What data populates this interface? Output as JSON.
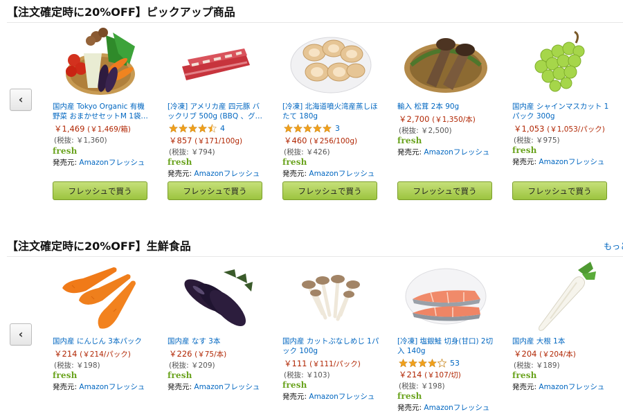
{
  "sections": [
    {
      "title": "【注文確定時に20%OFF】ピックアップ商品",
      "products": [
        {
          "title": "国内産 Tokyo Organic 有機野菜 おまかせセットM 1袋…",
          "price": "￥1,469",
          "unit_price": "(￥1,469/箱)",
          "tax_excluded": "(税抜: ￥1,360)",
          "rating": null,
          "reviews": null,
          "fresh": "fresh",
          "seller_label": "発売元:",
          "seller": "Amazonフレッシュ",
          "button": "フレッシュで買う",
          "icon": "vegetable-basket-icon"
        },
        {
          "title": "[冷凍] アメリカ産 四元豚 バックリブ 500g (BBQ 、グ…",
          "price": "￥857",
          "unit_price": "(￥171/100g)",
          "tax_excluded": "(税抜: ￥794)",
          "rating": 4.5,
          "reviews": "4",
          "fresh": "fresh",
          "seller_label": "発売元:",
          "seller": "Amazonフレッシュ",
          "button": "フレッシュで買う",
          "icon": "pork-ribs-icon"
        },
        {
          "title": "[冷凍] 北海道噴火湾産蒸しほたて 180g",
          "price": "￥460",
          "unit_price": "(￥256/100g)",
          "tax_excluded": "(税抜: ￥426)",
          "rating": 5,
          "reviews": "3",
          "fresh": "fresh",
          "seller_label": "発売元:",
          "seller": "Amazonフレッシュ",
          "button": "フレッシュで買う",
          "icon": "scallop-plate-icon"
        },
        {
          "title": "輸入 松茸 2本 90g",
          "price": "￥2,700",
          "unit_price": "(￥1,350/本)",
          "tax_excluded": "(税抜: ￥2,500)",
          "rating": null,
          "reviews": null,
          "fresh": "fresh",
          "seller_label": "発売元:",
          "seller": "Amazonフレッシュ",
          "button": "フレッシュで買う",
          "icon": "matsutake-icon"
        },
        {
          "title": "国内産 シャインマスカット 1パック 300g",
          "price": "￥1,053",
          "unit_price": "(￥1,053/パック)",
          "tax_excluded": "(税抜: ￥975)",
          "rating": null,
          "reviews": null,
          "fresh": "fresh",
          "seller_label": "発売元:",
          "seller": "Amazonフレッシュ",
          "button": "フレッシュで買う",
          "icon": "grapes-icon"
        }
      ]
    },
    {
      "title": "【注文確定時に20%OFF】生鮮食品",
      "more": "もっと",
      "products": [
        {
          "title": "国内産 にんじん 3本パック",
          "price": "￥214",
          "unit_price": "(￥214/パック)",
          "tax_excluded": "(税抜: ￥198)",
          "rating": null,
          "reviews": null,
          "fresh": "fresh",
          "seller_label": "発売元:",
          "seller": "Amazonフレッシュ",
          "icon": "carrot-icon"
        },
        {
          "title": "国内産 なす 3本",
          "price": "￥226",
          "unit_price": "(￥75/本)",
          "tax_excluded": "(税抜: ￥209)",
          "rating": null,
          "reviews": null,
          "fresh": "fresh",
          "seller_label": "発売元:",
          "seller": "Amazonフレッシュ",
          "icon": "eggplant-icon"
        },
        {
          "title": "国内産 カットぶなしめじ 1パック 100g",
          "price": "￥111",
          "unit_price": "(￥111/パック)",
          "tax_excluded": "(税抜: ￥103)",
          "rating": null,
          "reviews": null,
          "fresh": "fresh",
          "seller_label": "発売元:",
          "seller": "Amazonフレッシュ",
          "icon": "shimeji-icon"
        },
        {
          "title": "[冷凍] 塩銀鮭 切身(甘口) 2切入 140g",
          "price": "￥214",
          "unit_price": "(￥107/切)",
          "tax_excluded": "(税抜: ￥198)",
          "rating": 4,
          "reviews": "53",
          "fresh": "fresh",
          "seller_label": "発売元:",
          "seller": "Amazonフレッシュ",
          "icon": "salmon-icon"
        },
        {
          "title": "国内産 大根 1本",
          "price": "￥204",
          "unit_price": "(￥204/本)",
          "tax_excluded": "(税抜: ￥189)",
          "rating": null,
          "reviews": null,
          "fresh": "fresh",
          "seller_label": "発売元:",
          "seller": "Amazonフレッシュ",
          "icon": "daikon-icon"
        }
      ]
    }
  ],
  "prev_arrow": "‹",
  "colors": {
    "link": "#0066c0",
    "price": "#b12704",
    "star": "#f0a01c",
    "fresh": "#6aa31e",
    "button": "#a4c639"
  }
}
